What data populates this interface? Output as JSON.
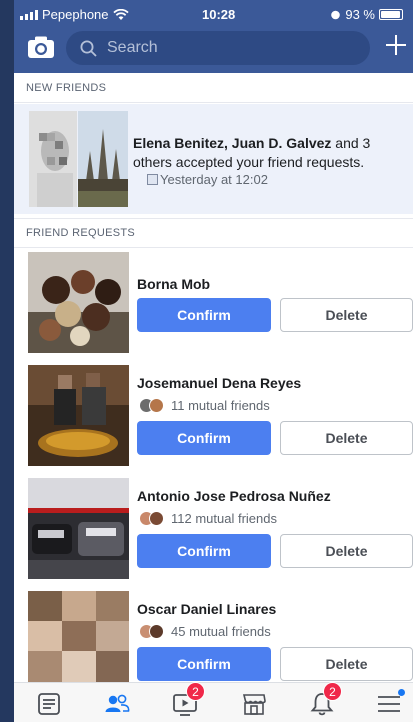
{
  "status_bar": {
    "carrier": "Pepephone",
    "time": "10:28",
    "battery": "93 %"
  },
  "header": {
    "search_placeholder": "Search"
  },
  "sections": {
    "new_friends": "NEW FRIENDS",
    "friend_requests": "FRIEND REQUESTS"
  },
  "notification": {
    "names": "Elena Benitez, Juan D. Galvez",
    "rest": " and 3 others accepted your friend requests.",
    "time": "Yesterday at 12:02"
  },
  "requests": [
    {
      "name": "Borna Mob",
      "mutual": "",
      "confirm": "Confirm",
      "delete": "Delete"
    },
    {
      "name": "Josemanuel Dena Reyes",
      "mutual": "11 mutual friends",
      "confirm": "Confirm",
      "delete": "Delete"
    },
    {
      "name": "Antonio Jose Pedrosa Nuñez",
      "mutual": "112 mutual friends",
      "confirm": "Confirm",
      "delete": "Delete"
    },
    {
      "name": "Oscar Daniel Linares",
      "mutual": "45 mutual friends",
      "confirm": "Confirm",
      "delete": "Delete"
    }
  ],
  "bottom_nav": [
    {
      "icon": "news-feed-icon",
      "badge": ""
    },
    {
      "icon": "friends-icon",
      "badge": ""
    },
    {
      "icon": "watch-icon",
      "badge": "2"
    },
    {
      "icon": "marketplace-icon",
      "badge": ""
    },
    {
      "icon": "notifications-icon",
      "badge": "2"
    },
    {
      "icon": "menu-icon",
      "badge": ""
    }
  ],
  "colors": {
    "header": "#3b5998",
    "confirm": "#4c7ff0",
    "active_tab": "#1877f2",
    "badge": "#f02849"
  }
}
